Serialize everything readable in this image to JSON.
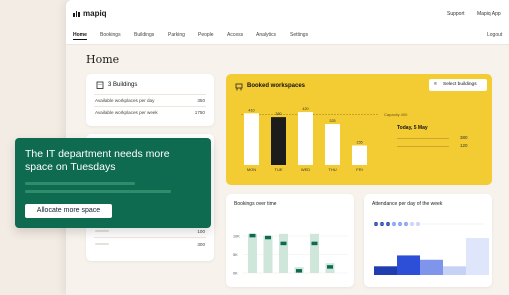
{
  "header": {
    "logo_text": "mapiq",
    "support": "Support",
    "app": "Mapiq App"
  },
  "nav": {
    "items": [
      "Home",
      "Bookings",
      "Buildings",
      "Parking",
      "People",
      "Access",
      "Analytics",
      "Settings"
    ],
    "active": "Home",
    "logout": "Logout"
  },
  "page_title": "Home",
  "buildings_card": {
    "title": "3 Buildings",
    "rows": [
      {
        "label": "Available workplaces per day",
        "value": "350"
      },
      {
        "label": "Available workplaces per week",
        "value": "1750"
      }
    ]
  },
  "lower_card": {
    "values": [
      "100",
      "300"
    ]
  },
  "booked": {
    "title": "Booked workspaces",
    "select_label": "Select buildings",
    "capacity_label": "Capacity 400",
    "today_label": "Today, 5 May",
    "today_values": [
      "380",
      "120"
    ],
    "colors": {
      "background": "#f3cc33",
      "bar": "#ffffff",
      "today": "#1c1c1c"
    }
  },
  "chart_data": [
    {
      "type": "bar",
      "title": "Booked workspaces",
      "categories": [
        "MON",
        "TUE",
        "WED",
        "THU",
        "FRI"
      ],
      "values": [
        410,
        380,
        420,
        325,
        155
      ],
      "ylim": [
        0,
        500
      ],
      "capacity": 400,
      "highlight": "TUE"
    },
    {
      "type": "bar",
      "title": "Bookings over time",
      "y_ticks": [
        "10K",
        "5K",
        "0K"
      ],
      "series": [
        {
          "values": [
            10,
            9.5,
            10,
            1.5,
            10,
            2.5
          ]
        },
        {
          "values": [
            10,
            9.5,
            8,
            1,
            8,
            2
          ]
        }
      ],
      "ylim": [
        0,
        12
      ],
      "colors": [
        "#cfe6da",
        "#0f6b4f"
      ]
    },
    {
      "type": "bar",
      "title": "Attendance per day of the week",
      "values": [
        4,
        9,
        7,
        4,
        17
      ],
      "dots": [
        1,
        1,
        1,
        0.5,
        0.5,
        0.5,
        0.3,
        0.3
      ],
      "colors": [
        "#1f3db0",
        "#2d4fd8",
        "#7f95ec",
        "#c7d1f6",
        "#dfe5fb"
      ]
    }
  ]
}
